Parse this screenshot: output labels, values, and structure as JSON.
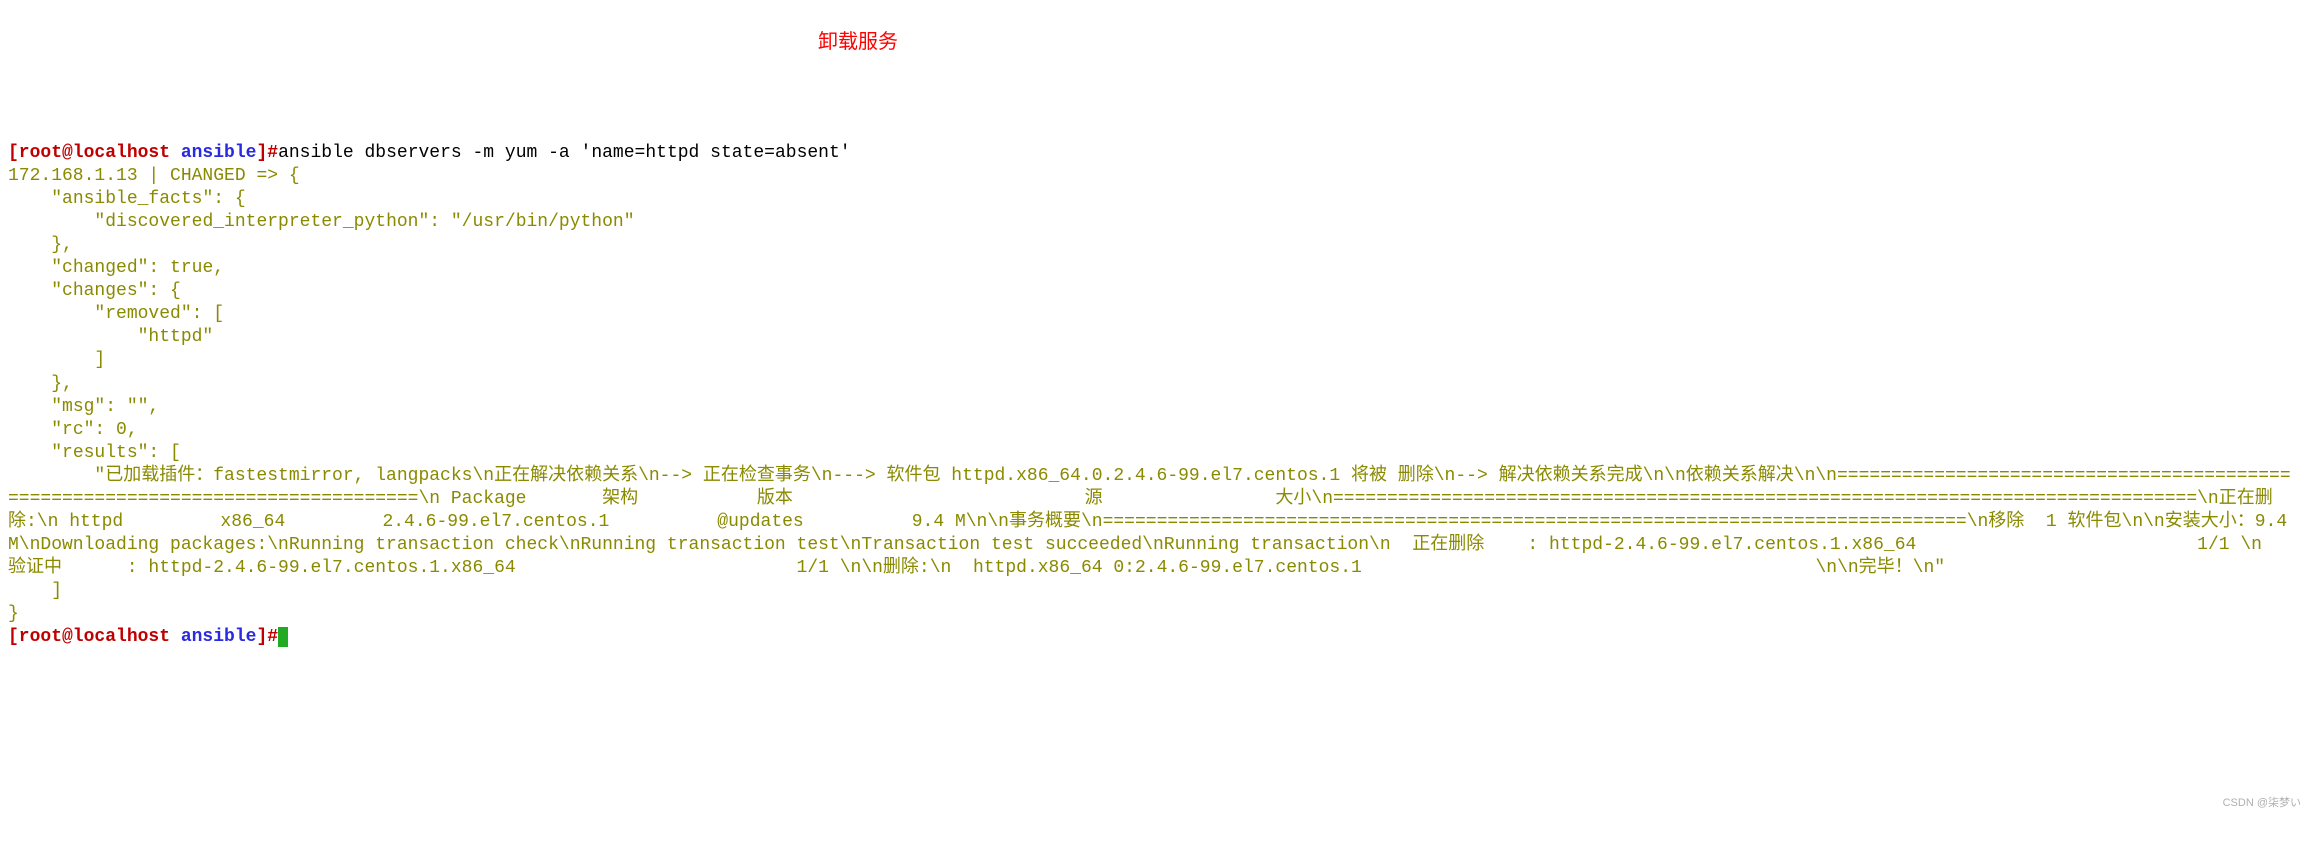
{
  "prompt1": {
    "user_host": "[root@localhost ",
    "dir": "ansible",
    "close": "]",
    "hash": "#",
    "command": "ansible dbservers -m yum -a 'name=httpd state=absent'"
  },
  "annotation": "卸载服务",
  "out_header": "172.168.1.13 | CHANGED => {",
  "out_facts1": "    \"ansible_facts\": {",
  "out_facts2": "        \"discovered_interpreter_python\": \"/usr/bin/python\"",
  "out_facts3": "    },",
  "out_changed": "    \"changed\": true,",
  "out_changes1": "    \"changes\": {",
  "out_changes2": "        \"removed\": [",
  "out_changes3": "            \"httpd\"",
  "out_changes4": "        ]",
  "out_changes5": "    },",
  "out_msg": "    \"msg\": \"\",",
  "out_rc": "    \"rc\": 0,",
  "out_results_open": "    \"results\": [",
  "out_results_body": "        \"已加载插件：fastestmirror, langpacks\\n正在解决依赖关系\\n--> 正在检查事务\\n---> 软件包 httpd.x86_64.0.2.4.6-99.el7.centos.1 将被 删除\\n--> 解决依赖关系完成\\n\\n依赖关系解决\\n\\n================================================================================\\n Package       架构           版本                           源                大小\\n================================================================================\\n正在删除:\\n httpd         x86_64         2.4.6-99.el7.centos.1          @updates          9.4 M\\n\\n事务概要\\n================================================================================\\n移除  1 软件包\\n\\n安装大小：9.4 M\\nDownloading packages:\\nRunning transaction check\\nRunning transaction test\\nTransaction test succeeded\\nRunning transaction\\n  正在删除    : httpd-2.4.6-99.el7.centos.1.x86_64                          1/1 \\n  验证中      : httpd-2.4.6-99.el7.centos.1.x86_64                          1/1 \\n\\n删除:\\n  httpd.x86_64 0:2.4.6-99.el7.centos.1                                          \\n\\n完毕！\\n\"",
  "out_results_close": "    ]",
  "out_close": "}",
  "prompt2": {
    "user_host": "[root@localhost ",
    "dir": "ansible",
    "close": "]",
    "hash": "#"
  },
  "watermark": "CSDN @柒梦い"
}
